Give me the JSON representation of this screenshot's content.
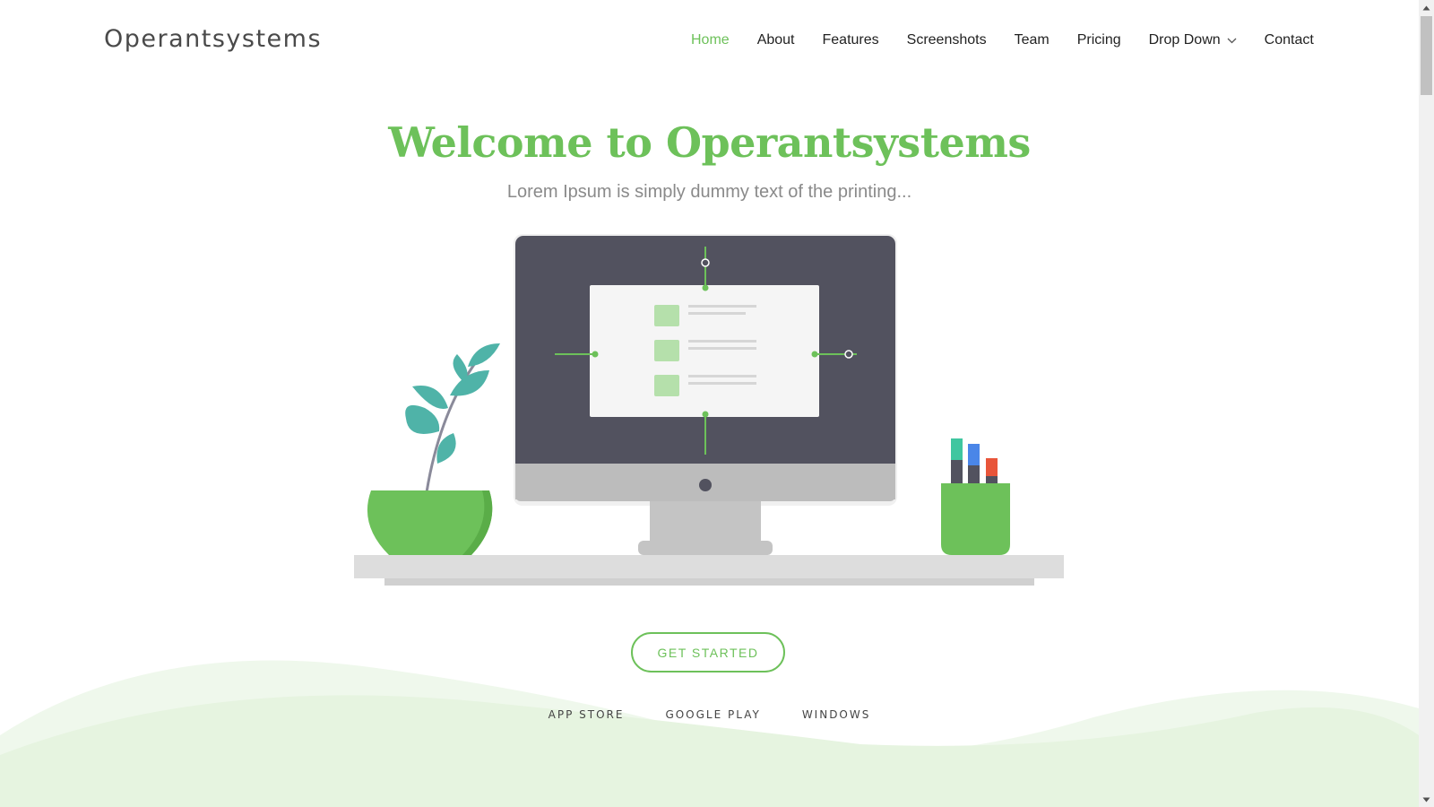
{
  "brand": {
    "name": "Operantsystems"
  },
  "nav": {
    "items": [
      {
        "label": "Home",
        "active": true
      },
      {
        "label": "About"
      },
      {
        "label": "Features"
      },
      {
        "label": "Screenshots"
      },
      {
        "label": "Team"
      },
      {
        "label": "Pricing"
      },
      {
        "label": "Drop Down",
        "dropdown": true
      },
      {
        "label": "Contact"
      }
    ]
  },
  "hero": {
    "title": "Welcome to Operantsystems",
    "subtitle": "Lorem Ipsum is simply dummy text of the printing...",
    "cta_label": "GET STARTED"
  },
  "stores": {
    "app_store": "APP STORE",
    "google_play": "GOOGLE PLAY",
    "windows": "WINDOWS"
  },
  "colors": {
    "accent": "#6dc15a",
    "monitor_screen": "#52525f",
    "teal_leaf": "#4fb3a8",
    "marker_teal": "#3fc6a0",
    "marker_blue": "#4a86e8",
    "marker_red": "#e8553a"
  }
}
